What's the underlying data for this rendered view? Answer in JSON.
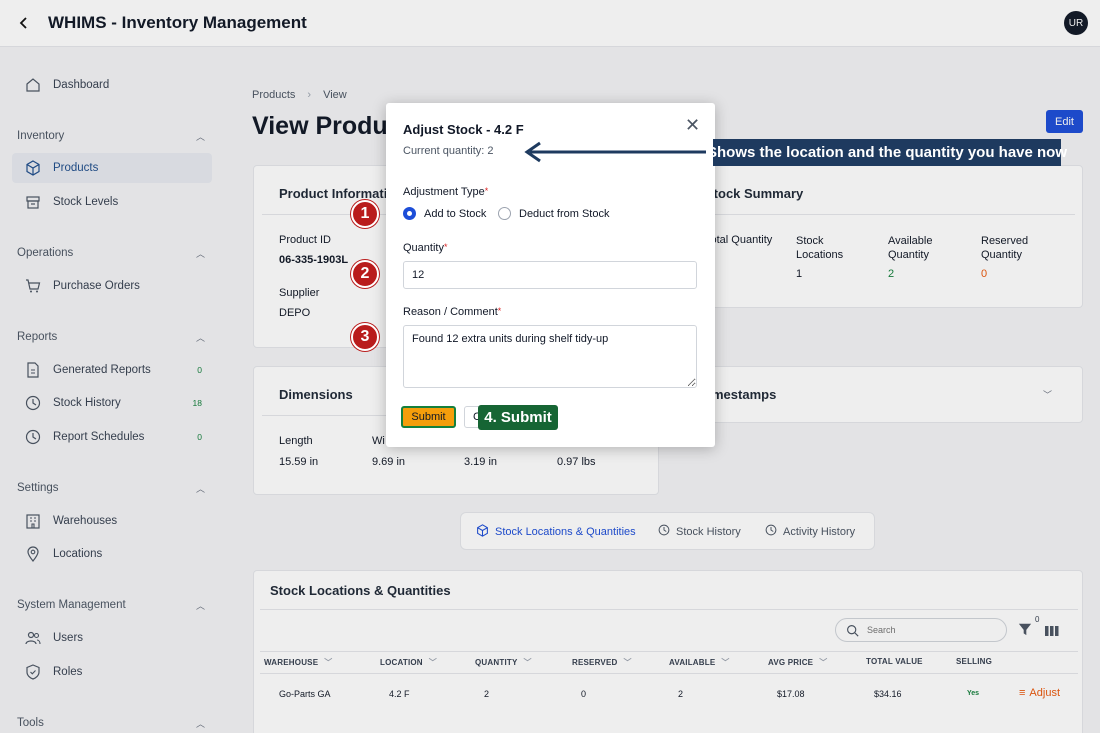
{
  "header": {
    "title": "WHIMS - Inventory Management",
    "avatar": "UR"
  },
  "sidebar": {
    "dashboard": "Dashboard",
    "inventory": {
      "label": "Inventory",
      "products": "Products",
      "stock_levels": "Stock Levels"
    },
    "operations": {
      "label": "Operations",
      "purchase_orders": "Purchase Orders"
    },
    "reports": {
      "label": "Reports",
      "generated": "Generated Reports",
      "generated_count": "0",
      "stock_history": "Stock History",
      "stock_history_count": "18",
      "schedules": "Report Schedules",
      "schedules_count": "0"
    },
    "settings": {
      "label": "Settings",
      "warehouses": "Warehouses",
      "locations": "Locations"
    },
    "system": {
      "label": "System Management",
      "users": "Users",
      "roles": "Roles"
    },
    "tools": {
      "label": "Tools"
    }
  },
  "breadcrumb": {
    "products": "Products",
    "view": "View"
  },
  "page": {
    "title": "View Product",
    "edit": "Edit"
  },
  "product_info": {
    "title": "Product Information",
    "product_id_label": "Product ID",
    "product_id": "06-335-1903L",
    "supplier_label": "Supplier",
    "supplier": "DEPO"
  },
  "stock_summary": {
    "title": "Stock Summary",
    "total_label": "Total Quantity",
    "locations_label": "Stock Locations",
    "locations": "1",
    "available_label": "Available Quantity",
    "available": "2",
    "reserved_label": "Reserved Quantity",
    "reserved": "0"
  },
  "dimensions": {
    "title": "Dimensions",
    "length_label": "Length",
    "length": "15.59 in",
    "width_label": "Wi",
    "width": "9.69 in",
    "height": "3.19 in",
    "weight": "0.97 lbs"
  },
  "timestamps": {
    "title": "mestamps"
  },
  "tabs": {
    "locations": "Stock Locations & Quantities",
    "history": "Stock History",
    "activity": "Activity History"
  },
  "table": {
    "title": "Stock Locations & Quantities",
    "search_placeholder": "Search",
    "filter_count": "0",
    "headers": [
      "WAREHOUSE",
      "LOCATION",
      "QUANTITY",
      "RESERVED",
      "AVAILABLE",
      "AVG PRICE",
      "TOTAL VALUE",
      "SELLING"
    ],
    "row": {
      "warehouse": "Go-Parts GA",
      "location": "4.2 F",
      "quantity": "2",
      "reserved": "0",
      "available": "2",
      "avg_price": "$17.08",
      "total_value": "$34.16",
      "selling": "Yes",
      "action": "Adjust"
    }
  },
  "modal": {
    "title": "Adjust Stock - 4.2 F",
    "current": "Current quantity: 2",
    "type_label": "Adjustment Type",
    "add_option": "Add to Stock",
    "deduct_option": "Deduct from Stock",
    "quantity_label": "Quantity",
    "quantity_value": "12",
    "reason_label": "Reason / Comment",
    "reason_value": "Found 12 extra units during shelf tidy-up",
    "submit": "Submit",
    "cancel": "C"
  },
  "annotations": {
    "callout": "Shows the location and the quantity you have now",
    "step1": "1",
    "step2": "2",
    "step3": "3",
    "step4": "4. Submit"
  },
  "colors": {
    "primary": "#1d4ed8",
    "submit": "#f59e0b",
    "step": "#b91c1c",
    "callout": "#1e3a5f",
    "green_callout": "#166534"
  }
}
